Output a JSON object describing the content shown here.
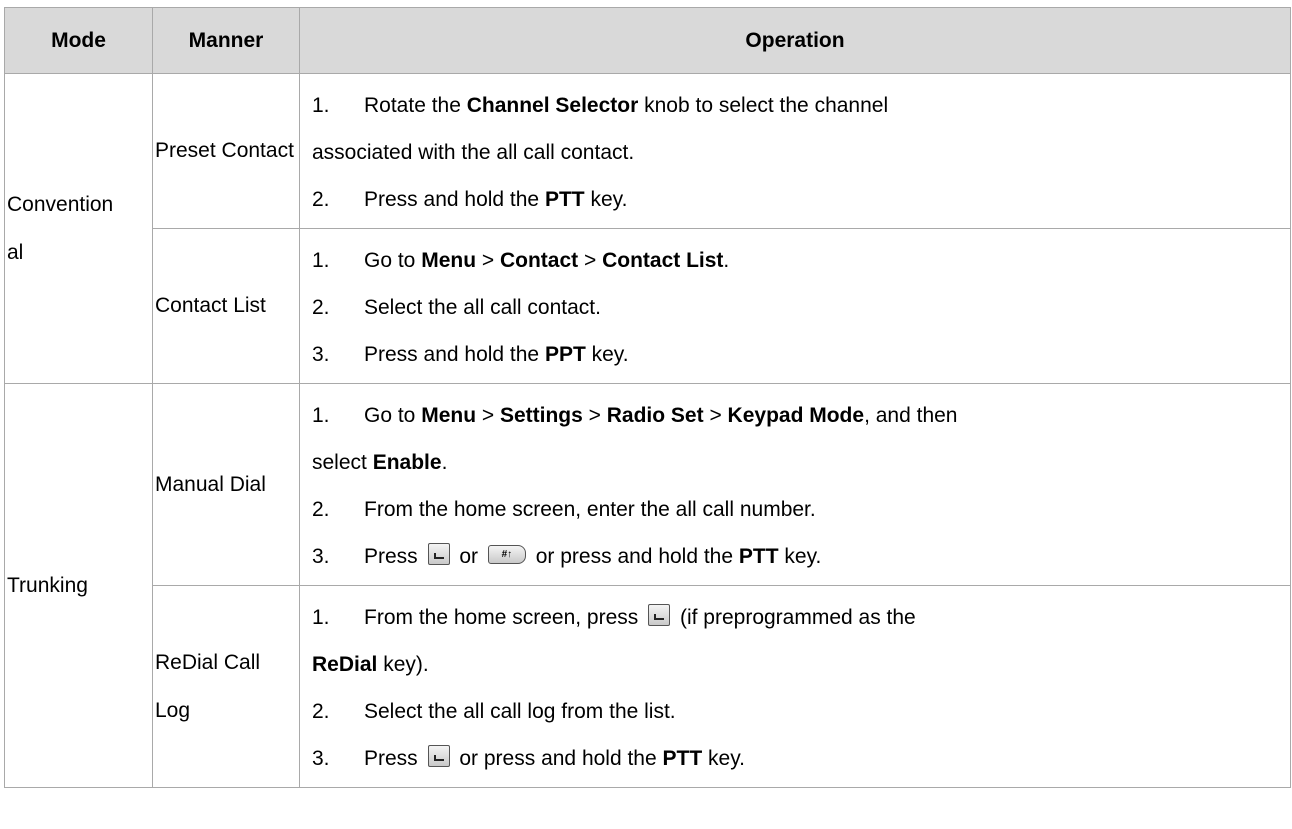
{
  "headers": {
    "mode": "Mode",
    "manner": "Manner",
    "operation": "Operation"
  },
  "rows": {
    "conventional": {
      "mode_line1": "Convention",
      "mode_line2": "al",
      "preset_contact": {
        "manner": "Preset Contact",
        "step1": {
          "num": "1.",
          "pre": "Rotate the ",
          "b1": "Channel Selector",
          "post": " knob to select the channel"
        },
        "step1_cont": "associated with the all call contact.",
        "step2": {
          "num": "2.",
          "pre": "Press and hold the ",
          "b1": "PTT",
          "post": " key."
        }
      },
      "contact_list": {
        "manner": "Contact List",
        "step1": {
          "num": "1.",
          "pre": "Go to ",
          "b1": "Menu",
          "sep1": " > ",
          "b2": "Contact",
          "sep2": " > ",
          "b3": "Contact List",
          "post": "."
        },
        "step2": {
          "num": "2.",
          "text": "Select the all call contact."
        },
        "step3": {
          "num": "3.",
          "pre": "Press and hold the ",
          "b1": "PPT",
          "post": " key."
        }
      }
    },
    "trunking": {
      "mode": "Trunking",
      "manual_dial": {
        "manner": "Manual Dial",
        "step1": {
          "num": "1.",
          "pre": "Go to ",
          "b1": "Menu",
          "sep1": " > ",
          "b2": "Settings",
          "sep2": " > ",
          "b3": "Radio Set",
          "sep3": " > ",
          "b4": "Keypad Mode",
          "post": ", and then"
        },
        "step1_cont": {
          "pre": "select ",
          "b1": "Enable",
          "post": "."
        },
        "step2": {
          "num": "2.",
          "text": "From the home screen, enter the all call number."
        },
        "step3": {
          "num": "3.",
          "pre": "Press",
          "or1": "or",
          "post_pre": "or press and hold the ",
          "b1": "PTT",
          "post": " key.",
          "hash_key_label": "#↑"
        }
      },
      "redial_call_log": {
        "manner": "ReDial Call Log",
        "step1": {
          "num": "1.",
          "pre": "From the home screen, press",
          "post": "(if preprogrammed as the"
        },
        "step1_cont": {
          "b1": "ReDial",
          "post": " key)."
        },
        "step2": {
          "num": "2.",
          "text": "Select the all call log from the list."
        },
        "step3": {
          "num": "3.",
          "pre": "Press",
          "post_pre": "or press and hold the ",
          "b1": "PTT",
          "post": " key."
        }
      }
    }
  },
  "icons": {
    "send_key": "send-softkey-icon",
    "hash_key": "hash-key-icon"
  }
}
